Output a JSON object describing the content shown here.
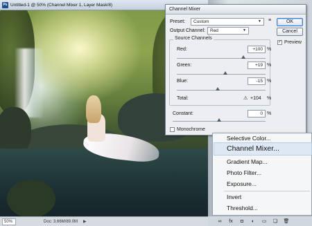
{
  "document": {
    "title": "Untitled-1 @ 50% (Channel Mixer 1, Layer Mask/8)",
    "app_badge": "Ps",
    "status": {
      "zoom": "50%",
      "doc_info": "Doc: 3.66M/89.0M"
    }
  },
  "dialog": {
    "title": "Channel Mixer",
    "preset_label": "Preset:",
    "preset_value": "Custom",
    "output_label": "Output Channel:",
    "output_value": "Red",
    "source_channels_label": "Source Channels",
    "red_label": "Red:",
    "red_value": "+100",
    "red_level": 100,
    "green_label": "Green:",
    "green_value": "+19",
    "green_level": 19,
    "blue_label": "Blue:",
    "blue_value": "-15",
    "blue_level": -15,
    "total_label": "Total:",
    "total_value": "+104",
    "constant_label": "Constant:",
    "constant_value": "0",
    "constant_level": 0,
    "percent": "%",
    "ok_label": "OK",
    "cancel_label": "Cancel",
    "preview_label": "Preview",
    "preview_checked": true,
    "monochrome_label": "Monochrome",
    "monochrome_checked": false
  },
  "menu": {
    "items": [
      "Selective Color...",
      "Channel Mixer...",
      "Gradient Map...",
      "Photo Filter...",
      "Exposure...",
      "Invert",
      "Threshold..."
    ],
    "highlighted": "Channel Mixer..."
  },
  "layers_toolbar": {
    "icons": [
      "link-layers-icon",
      "fx-icon",
      "add-mask-icon",
      "adjustment-layer-icon",
      "folder-icon",
      "new-layer-icon",
      "trash-icon"
    ]
  }
}
